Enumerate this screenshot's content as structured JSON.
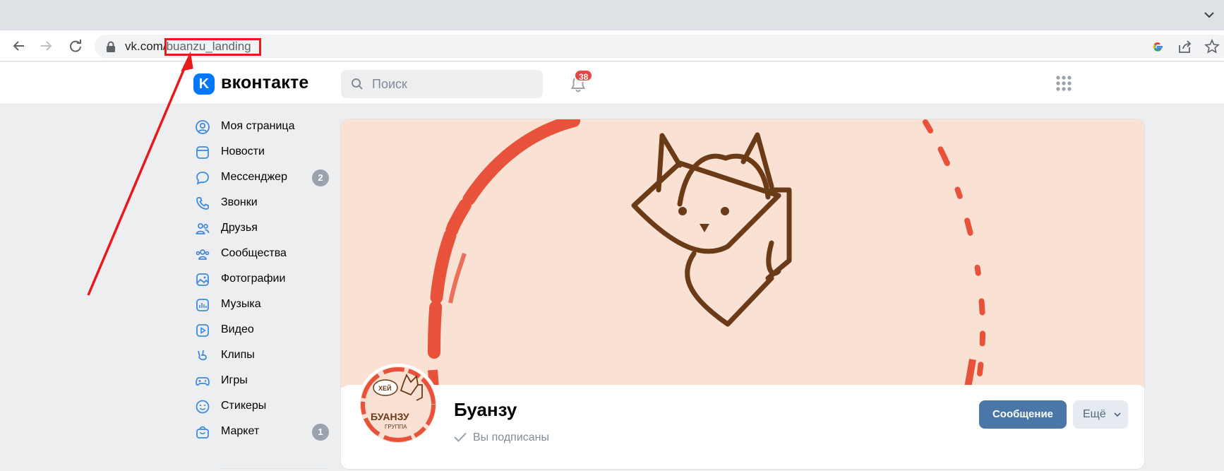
{
  "browser": {
    "url_host": "vk.com/",
    "url_path": "buanzu_landing"
  },
  "header": {
    "brand": "вконтакте",
    "logo_letter": "K",
    "search_placeholder": "Поиск",
    "notifications_count": "38"
  },
  "sidebar": {
    "items": [
      {
        "label": "Моя страница",
        "icon": "user-circle-icon"
      },
      {
        "label": "Новости",
        "icon": "news-icon"
      },
      {
        "label": "Мессенджер",
        "icon": "message-icon",
        "count": "2"
      },
      {
        "label": "Звонки",
        "icon": "phone-icon"
      },
      {
        "label": "Друзья",
        "icon": "friends-icon"
      },
      {
        "label": "Сообщества",
        "icon": "communities-icon"
      },
      {
        "label": "Фотографии",
        "icon": "photo-icon"
      },
      {
        "label": "Музыка",
        "icon": "music-icon"
      },
      {
        "label": "Видео",
        "icon": "video-icon"
      },
      {
        "label": "Клипы",
        "icon": "clips-icon"
      },
      {
        "label": "Игры",
        "icon": "gamepad-icon"
      },
      {
        "label": "Стикеры",
        "icon": "smile-icon"
      },
      {
        "label": "Маркет",
        "icon": "market-bag-icon",
        "count": "1"
      }
    ]
  },
  "profile": {
    "name": "Буанзу",
    "subscribed_label": "Вы подписаны",
    "message_button": "Сообщение",
    "more_button": "Ещё",
    "avatar_text_top": "ХЕЙ",
    "avatar_text_main": "БУАНЗУ",
    "avatar_text_sub": "ГРУППА"
  },
  "colors": {
    "accent": "#4a76a8",
    "vk_blue": "#0077ff",
    "annotation_red": "#e8191a",
    "cover_bg": "#f9e1d4",
    "fox_brown": "#6b3a17"
  }
}
